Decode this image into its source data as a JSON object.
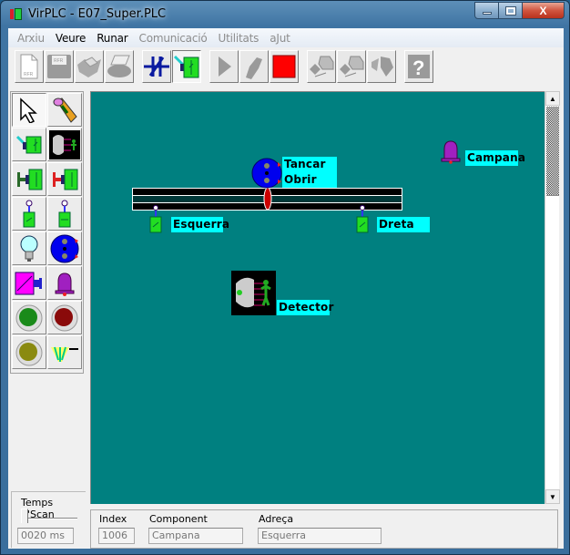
{
  "window": {
    "title": "VirPLC - E07_Super.PLC",
    "controls": {
      "minimize": "minimize",
      "maximize": "maximize",
      "close": "X"
    }
  },
  "menubar": {
    "items": [
      {
        "label": "Arxiu",
        "enabled": false
      },
      {
        "label": "Veure",
        "enabled": true
      },
      {
        "label": "Runar",
        "enabled": true
      },
      {
        "label": "Comunicació",
        "enabled": false
      },
      {
        "label": "Utilitats",
        "enabled": false
      },
      {
        "label": "aJut",
        "enabled": false
      }
    ]
  },
  "toolbar": {
    "buttons": [
      {
        "name": "new-file",
        "icon": "new-document-icon",
        "enabled": false
      },
      {
        "name": "save-file",
        "icon": "floppy-disk-icon",
        "enabled": false
      },
      {
        "name": "open-file",
        "icon": "open-folder-icon",
        "enabled": false
      },
      {
        "name": "print",
        "icon": "printer-icon",
        "enabled": false
      },
      {
        "name": "ladder-editor",
        "icon": "ladder-contact-icon",
        "enabled": true
      },
      {
        "name": "simulation-view",
        "icon": "switch-panel-icon",
        "enabled": true,
        "pressed": true
      },
      {
        "name": "run",
        "icon": "play-icon",
        "enabled": false
      },
      {
        "name": "step",
        "icon": "foot-step-icon",
        "enabled": false
      },
      {
        "name": "stop",
        "icon": "stop-icon",
        "enabled": true
      },
      {
        "name": "upload",
        "icon": "upload-plc-icon",
        "enabled": false
      },
      {
        "name": "download",
        "icon": "download-plc-icon",
        "enabled": false
      },
      {
        "name": "disconnect",
        "icon": "disconnect-plc-icon",
        "enabled": false
      },
      {
        "name": "help",
        "icon": "help-icon",
        "enabled": false
      }
    ]
  },
  "palette": {
    "tools": [
      {
        "name": "pointer",
        "icon": "arrow-pointer-icon",
        "pressed": true
      },
      {
        "name": "wire",
        "icon": "pencil-icon"
      },
      {
        "name": "toggle-switch",
        "icon": "toggle-switch-icon"
      },
      {
        "name": "presence-detector",
        "icon": "presence-detector-icon"
      },
      {
        "name": "push-button-green",
        "icon": "green-pushbutton-icon"
      },
      {
        "name": "push-button-red",
        "icon": "red-pushbutton-icon"
      },
      {
        "name": "limit-switch-nc",
        "icon": "limit-switch-icon"
      },
      {
        "name": "limit-switch-no",
        "icon": "limit-switch-icon"
      },
      {
        "name": "lamp",
        "icon": "light-bulb-icon"
      },
      {
        "name": "motor",
        "icon": "motor-icon"
      },
      {
        "name": "solenoid",
        "icon": "solenoid-icon"
      },
      {
        "name": "bell",
        "icon": "bell-icon"
      },
      {
        "name": "green-pilot",
        "icon": "green-pilot-light-icon"
      },
      {
        "name": "red-pilot",
        "icon": "red-pilot-light-icon"
      },
      {
        "name": "yellow-pilot",
        "icon": "yellow-pilot-light-icon"
      },
      {
        "name": "level-sensor",
        "icon": "level-sensor-icon"
      }
    ]
  },
  "canvas": {
    "background": "#008080",
    "components": {
      "motor": {
        "labels": [
          "Tancar",
          "Obrir"
        ]
      },
      "left_switch": {
        "label": "Esquerra"
      },
      "right_switch": {
        "label": "Dreta"
      },
      "bell": {
        "label": "Campana"
      },
      "detector": {
        "label": "Detector"
      }
    }
  },
  "scrollbar": {
    "up": "▲",
    "down": "▼",
    "position": 0
  },
  "status": {
    "scan_time_legend": "Temps d'Scan",
    "scan_time_value": "0020 ms",
    "scan_slider_fraction": 0,
    "index_label": "Index",
    "index_value": "1006",
    "component_label": "Component",
    "component_value": "Campana",
    "address_label": "Adreça",
    "address_value": "Esquerra"
  },
  "colors": {
    "canvas": "#008080",
    "label_bg": "#00ffff",
    "stop_red": "#ff0000",
    "switch_green": "#22dd22"
  }
}
